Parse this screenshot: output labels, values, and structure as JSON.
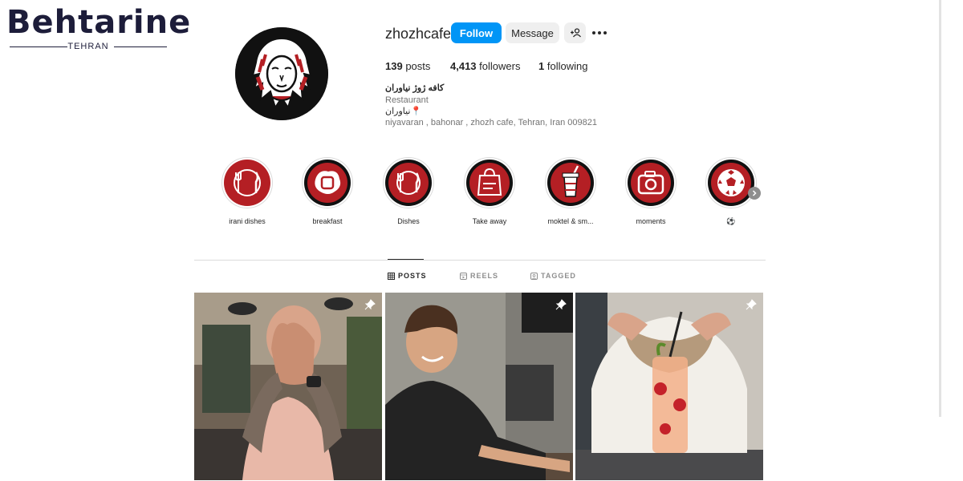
{
  "watermark": {
    "brand": "Behtarine",
    "city": "TEHRAN"
  },
  "profile": {
    "username": "zhozhcafe",
    "follow_label": "Follow",
    "message_label": "Message",
    "stats": {
      "posts_count": "139",
      "posts_label": "posts",
      "followers_count": "4,413",
      "followers_label": "followers",
      "following_count": "1",
      "following_label": "following"
    },
    "bio": {
      "name": "کافه ژوژ نیاوران",
      "category": "Restaurant",
      "line": "📍نیاوران",
      "address": "niyavaran , bahonar , zhozh cafe, Tehran, Iran 009821"
    }
  },
  "highlights": [
    {
      "label": "irani dishes",
      "icon": "plate-cutlery-icon"
    },
    {
      "label": "breakfast",
      "icon": "fried-egg-icon"
    },
    {
      "label": "Dishes",
      "icon": "plate-cutlery-icon"
    },
    {
      "label": "Take away",
      "icon": "takeaway-bag-icon"
    },
    {
      "label": "moktel & sm...",
      "icon": "drink-cup-icon"
    },
    {
      "label": "moments",
      "icon": "camera-icon"
    },
    {
      "label": "⚽",
      "icon": "soccer-ball-icon"
    }
  ],
  "tabs": [
    {
      "label": "POSTS",
      "icon": "grid-icon",
      "active": true
    },
    {
      "label": "REELS",
      "icon": "reels-icon",
      "active": false
    },
    {
      "label": "TAGGED",
      "icon": "tagged-icon",
      "active": false
    }
  ],
  "posts": [
    {
      "pinned": true,
      "icon": "pin-icon"
    },
    {
      "pinned": true,
      "icon": "pin-icon"
    },
    {
      "pinned": true,
      "icon": "pin-icon"
    }
  ],
  "colors": {
    "accent": "#0095f6",
    "brand_red": "#b41f24",
    "text": "#262626",
    "muted": "#737373"
  }
}
